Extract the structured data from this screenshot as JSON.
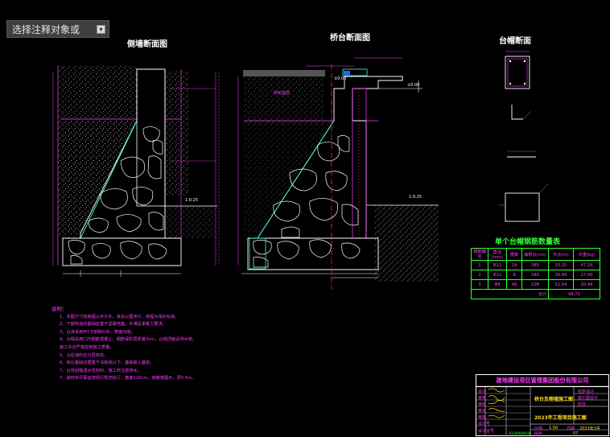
{
  "toolbar": {
    "hint": "选择注释对象或",
    "dropdown_icon": "dropdown-arrow-icon"
  },
  "drawing": {
    "title_left": "侧墙断面图",
    "title_mid": "桥台断面图",
    "title_right": "台帽断面",
    "label_gravel": "碎石垫层",
    "dim_a": "1:0.25",
    "dim_b": "1:0.25",
    "dim_c": "±0.00",
    "dim_d": "±0.00"
  },
  "notes": {
    "header": "说明：",
    "lines": [
      "1、本图尺寸除高程以米计外，其余以厘米计，高程为相对标高。",
      "2、下部构造的基础应置于坚硬地基，并满足承载力要求。",
      "3、台身采用M7.5浆砌片石，表面勾缝。",
      "4、台帽采用C25钢筋混凝土，钢筋保护层厚度3cm，台帽顶面设排水坡。",
      "   施工中应严格控制施工质量。",
      "5、台后填料应分层夯实。",
      "6、桥台基础应埋置于冻结线以下，基础嵌入基岩。",
      "7、台背回填透水性材料，施工时注意排水。",
      "7、其他未尽事宜按现行规范执行，宽度120cm，高度按图示，厚0.5m。"
    ]
  },
  "table": {
    "title": "单个台帽钢筋数量表",
    "headers": [
      "钢筋编号",
      "直径(mm)",
      "根数",
      "每根长(cm)",
      "共长(m)",
      "共重(kg)"
    ],
    "rows": [
      [
        "1",
        "Φ12",
        "14",
        "380",
        "53.20",
        "47.24"
      ],
      [
        "2",
        "Φ12",
        "8",
        "380",
        "30.40",
        "27.00"
      ],
      [
        "3",
        "Φ8",
        "48",
        "108",
        "51.84",
        "20.48"
      ]
    ],
    "total_label": "合计",
    "total_value": "94.72"
  },
  "titleblock": {
    "company": "晟地建设项目管理集团股份有限公司",
    "left_labels": [
      "设计",
      "复核",
      "审核",
      "审定",
      "审批",
      "设计号",
      "设计证号"
    ],
    "left_cells": [
      "",
      "",
      "",
      "",
      "",
      "",
      ""
    ],
    "project": "桥台及侧墙施工图",
    "sheet": "2023年工程项目施工图",
    "right_labels": [
      "初步设计",
      "施工图设计"
    ],
    "stage_label": "阶段",
    "scale_label": "比例",
    "scale_value": "1:50",
    "date_label": "日期",
    "date_value": "2023年3月",
    "drawing_no_label": "图号",
    "drawing_no_value": "07",
    "cert_no": "A1200000036"
  }
}
